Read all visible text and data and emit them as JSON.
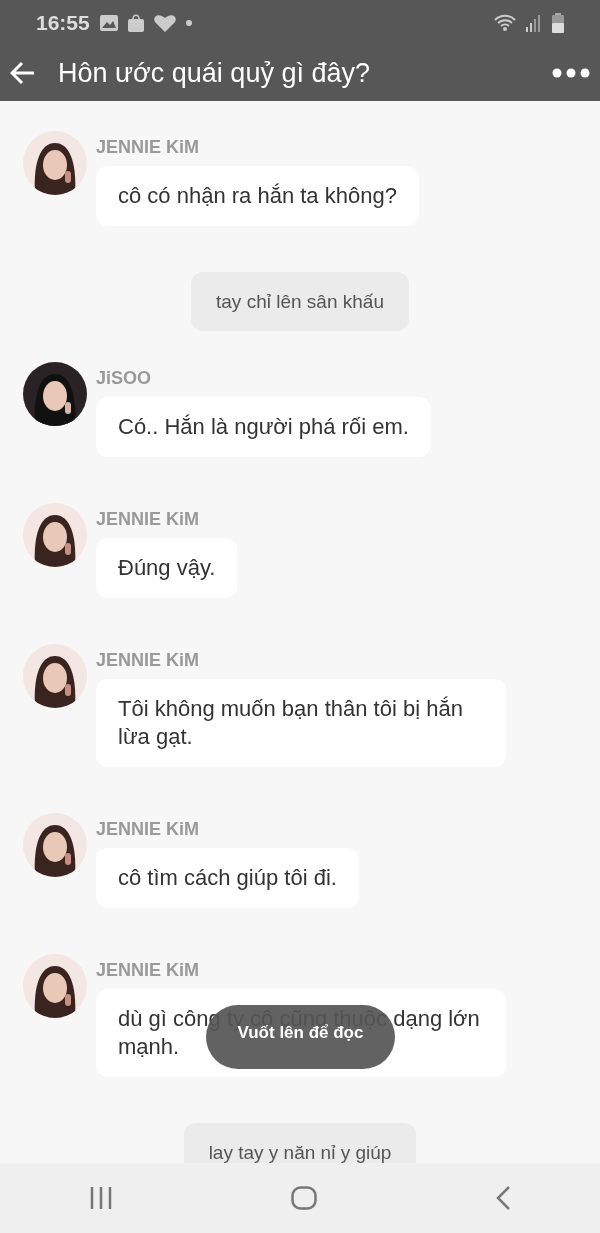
{
  "status_bar": {
    "time": "16:55"
  },
  "header": {
    "title": "Hôn ước quái quỷ gì đây?"
  },
  "messages": [
    {
      "kind": "chat",
      "sender": "JENNIE KiM",
      "text": "cô có nhận ra hắn ta không?"
    },
    {
      "kind": "narration",
      "text": "tay chỉ lên sân khấu"
    },
    {
      "kind": "chat",
      "sender": "JiSOO",
      "text": "Có.. Hắn là người phá rối em."
    },
    {
      "kind": "chat",
      "sender": "JENNIE KiM",
      "text": "Đúng vậy."
    },
    {
      "kind": "chat",
      "sender": "JENNIE KiM",
      "text": "Tôi không muốn bạn thân tôi bị hắn lừa gạt."
    },
    {
      "kind": "chat",
      "sender": "JENNIE KiM",
      "text": "cô tìm cách giúp tôi đi."
    },
    {
      "kind": "chat",
      "sender": "JENNIE KiM",
      "text": "dù gì công ty cô cũng thuộc dạng lớn mạnh."
    },
    {
      "kind": "narration",
      "text": "lay tay y năn nỉ y giúp"
    }
  ],
  "toast": {
    "text": "Vuốt lên để đọc"
  }
}
